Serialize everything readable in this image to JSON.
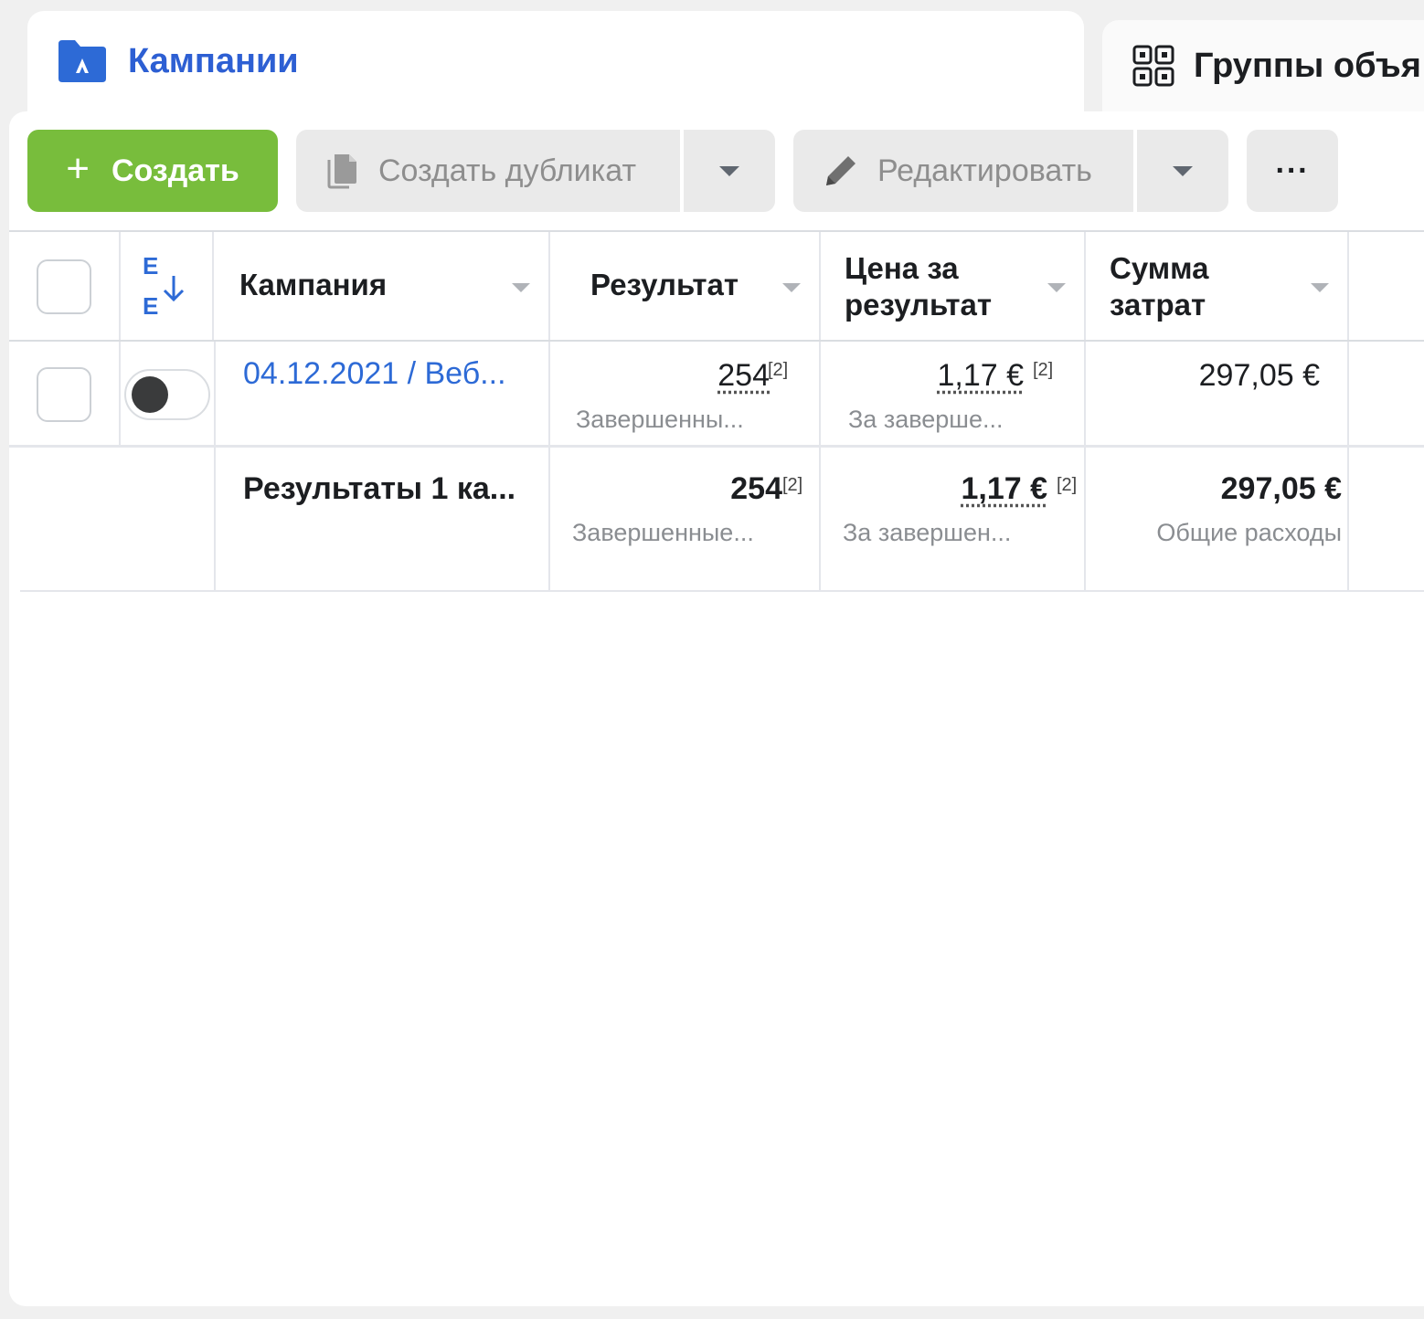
{
  "tabs": {
    "campaigns": {
      "label": "Кампании",
      "icon": "campaign-folder-icon"
    },
    "adsets": {
      "label": "Группы объя",
      "icon": "grid-icon"
    }
  },
  "toolbar": {
    "create_label": "Создать",
    "duplicate_label": "Создать дубликат",
    "edit_label": "Редактировать",
    "more_label": "···"
  },
  "table": {
    "headers": {
      "campaign": "Кампания",
      "result": "Результат",
      "cost_per_result_line1": "Цена за",
      "cost_per_result_line2": "результат",
      "spend_line1": "Сумма",
      "spend_line2": "затрат"
    },
    "rows": [
      {
        "name": "04.12.2021 / Веб...",
        "result": "254",
        "result_note": "[2]",
        "result_sub": "Завершенны...",
        "cost": "1,17 €",
        "cost_note": "[2]",
        "cost_sub": "За заверше...",
        "spend": "297,05 €",
        "toggle_on": false
      }
    ],
    "total": {
      "label": "Результаты 1 ка...",
      "result": "254",
      "result_note": "[2]",
      "result_sub": "Завершенные...",
      "cost": "1,17 €",
      "cost_note": "[2]",
      "cost_sub": "За завершен...",
      "spend": "297,05 €",
      "spend_sub": "Общие расходы"
    }
  },
  "colors": {
    "accent_blue": "#2d5fd3",
    "create_green": "#78bd3c",
    "link_blue": "#2d6ad6"
  }
}
